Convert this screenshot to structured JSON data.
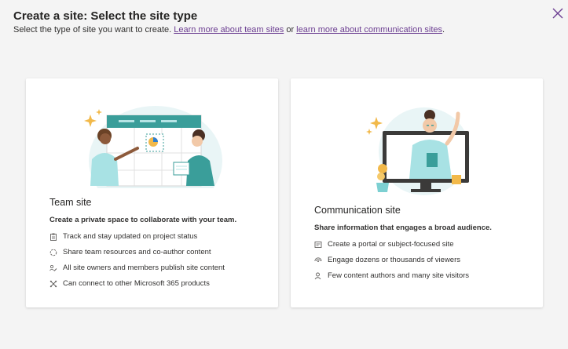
{
  "header": {
    "title": "Create a site: Select the site type",
    "subtitle_prefix": "Select the type of site you want to create.",
    "link_team": "Learn more about team sites",
    "subtitle_or": "or",
    "link_comm": "learn more about communication sites",
    "subtitle_suffix": "."
  },
  "close_icon": "close-icon",
  "team": {
    "title": "Team site",
    "description": "Create a private space to collaborate with your team.",
    "features": [
      {
        "icon": "clipboard-icon",
        "text": "Track and stay updated on project status"
      },
      {
        "icon": "sync-icon",
        "text": "Share team resources and co-author content"
      },
      {
        "icon": "people-edit-icon",
        "text": "All site owners and members publish site content"
      },
      {
        "icon": "connect-icon",
        "text": "Can connect to other Microsoft 365 products"
      }
    ]
  },
  "communication": {
    "title": "Communication site",
    "description": "Share information that engages a broad audience.",
    "features": [
      {
        "icon": "news-icon",
        "text": "Create a portal or subject-focused site"
      },
      {
        "icon": "broadcast-icon",
        "text": "Engage dozens or thousands of viewers"
      },
      {
        "icon": "person-icon",
        "text": "Few content authors and many site visitors"
      }
    ]
  },
  "colors": {
    "accent": "#6b3d91",
    "teal": "#3a9e9a",
    "light_teal": "#b6e4e5"
  }
}
